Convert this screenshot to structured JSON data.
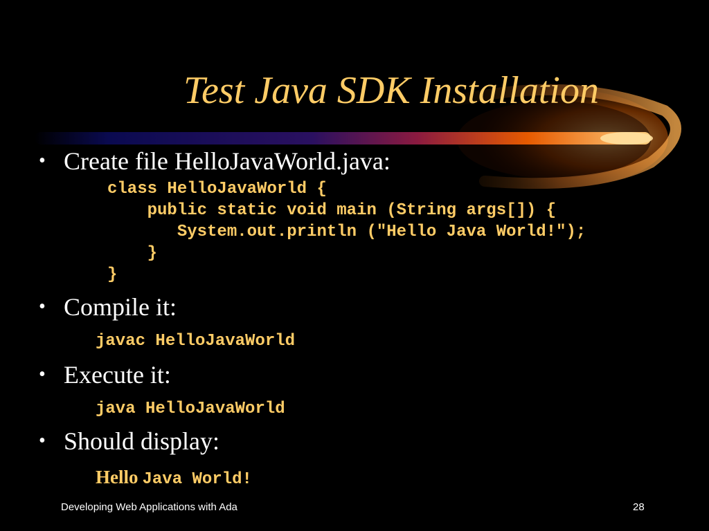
{
  "slide": {
    "title": "Test Java SDK Installation",
    "bullets": [
      {
        "text": "Create file HelloJavaWorld.java:",
        "code": [
          "class HelloJavaWorld {",
          "   public static void main (String args[]) {",
          "      System.out.println (\"Hello Java World!\");",
          "   }",
          "}"
        ]
      },
      {
        "text": "Compile it:",
        "code": [
          "javac HelloJavaWorld"
        ]
      },
      {
        "text": "Execute it:",
        "code": [
          "java HelloJavaWorld"
        ]
      },
      {
        "text": "Should display:",
        "output": {
          "part1": "Hello",
          "part2": "Java World!"
        }
      }
    ],
    "bullet_glyph": "•",
    "footer_left": "Developing Web Applications with Ada",
    "page_number": "28"
  },
  "colors": {
    "background": "#000000",
    "title": "#ffcc66",
    "text": "#ffffff",
    "code": "#ffcc66",
    "streak_start": "#0a0a50",
    "streak_mid": "#e65a00",
    "swoosh": "#ffaa33"
  }
}
